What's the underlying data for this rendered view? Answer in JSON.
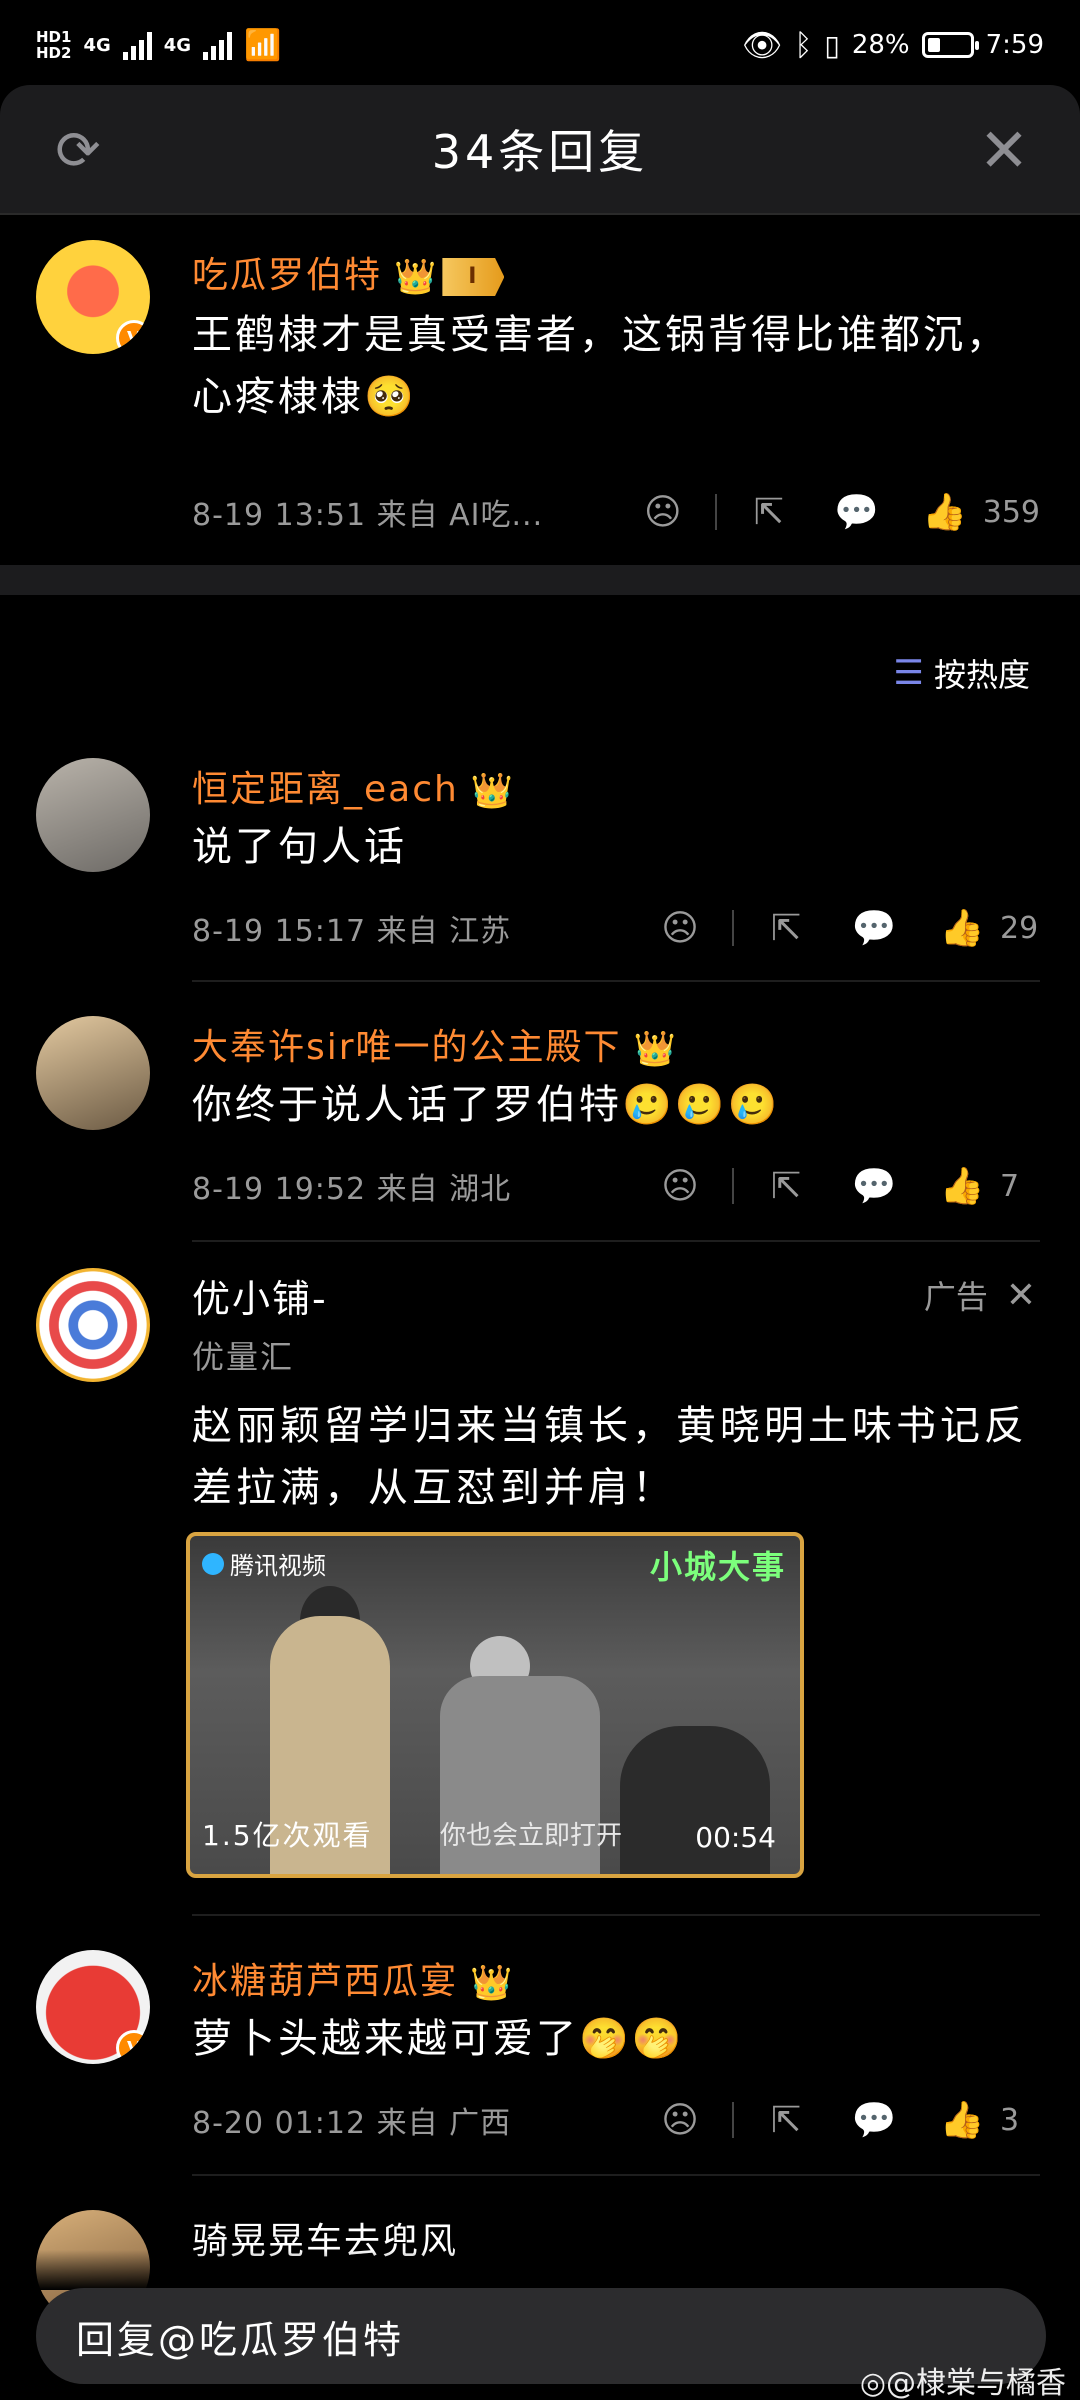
{
  "status_bar": {
    "left_hd1": "HD1",
    "left_hd2": "HD2",
    "net1": "4G",
    "net2": "4G",
    "battery_percent": "28%",
    "time": "7:59"
  },
  "header": {
    "title": "34条回复"
  },
  "main_comment": {
    "username": "吃瓜罗伯特",
    "rank": "I",
    "text": "王鹤棣才是真受害者，这锅背得比谁都沉，心疼棣棣🥺",
    "meta": "8-19 13:51  来自 AI吃...",
    "likes": "359"
  },
  "sort": {
    "label": "按热度"
  },
  "replies": [
    {
      "username": "恒定距离_each",
      "text": "说了句人话",
      "meta": "8-19 15:17  来自 江苏",
      "likes": "29"
    },
    {
      "username": "大奉许sir唯一的公主殿下",
      "text": "你终于说人话了罗伯特🥲🥲🥲",
      "meta": "8-19 19:52  来自 湖北",
      "likes": "7"
    },
    {
      "username": "冰糖葫芦西瓜宴",
      "text": "萝卜头越来越可爱了🤭🤭",
      "meta": "8-20 01:12  来自 广西",
      "likes": "3"
    },
    {
      "username": "骑晃晃车去兜风"
    }
  ],
  "ad": {
    "name": "优小铺-",
    "sub": "优量汇",
    "tag": "广告",
    "text": "赵丽颖留学归来当镇长，黄晓明土味书记反差拉满，从互怼到并肩！",
    "video": {
      "brand": "腾讯视频",
      "title": "小城大事",
      "views": "1.5亿次观看",
      "open": "你也会立即打开",
      "duration": "00:54"
    }
  },
  "reply_bar": {
    "placeholder": "回复@吃瓜罗伯特"
  },
  "watermark": "@棣棠与橘香"
}
